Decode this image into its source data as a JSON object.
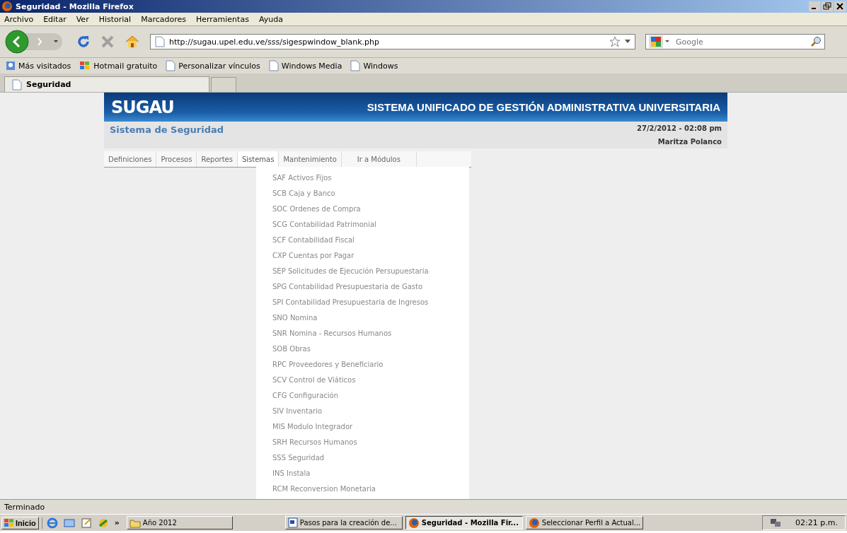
{
  "window": {
    "title": "Seguridad - Mozilla Firefox"
  },
  "menu_bar": [
    "Archivo",
    "Editar",
    "Ver",
    "Historial",
    "Marcadores",
    "Herramientas",
    "Ayuda"
  ],
  "address_bar": {
    "value": "http://sugau.upel.edu.ve/sss/sigespwindow_blank.php"
  },
  "search_field": {
    "placeholder": "Google"
  },
  "bookmarks": [
    {
      "label": "Más visitados",
      "kind": "smart"
    },
    {
      "label": "Hotmail gratuito",
      "kind": "windows"
    },
    {
      "label": "Personalizar vínculos",
      "kind": "page"
    },
    {
      "label": "Windows Media",
      "kind": "page"
    },
    {
      "label": "Windows",
      "kind": "page"
    }
  ],
  "tabs": [
    {
      "label": "Seguridad",
      "selected": true
    }
  ],
  "page": {
    "logo": "SUGAU",
    "banner_title": "SISTEMA UNIFICADO DE GESTIÓN ADMINISTRATIVA UNIVERSITARIA",
    "subtitle": "Sistema de Seguridad",
    "datetime": "27/2/2012 - 02:08 pm",
    "user": "Maritza Polanco",
    "menu": [
      {
        "label": "Definiciones",
        "selected": false
      },
      {
        "label": "Procesos",
        "selected": false
      },
      {
        "label": "Reportes",
        "selected": false
      },
      {
        "label": "Sistemas",
        "selected": true
      },
      {
        "label": "Mantenimiento",
        "selected": false
      },
      {
        "label": "Ir a Módulos",
        "selected": false
      }
    ],
    "dropdown": [
      "SAF Activos Fijos",
      "SCB Caja y Banco",
      "SOC Ordenes de Compra",
      "SCG Contabilidad Patrimonial",
      "SCF Contabilidad Fiscal",
      "CXP Cuentas por Pagar",
      "SEP Solicitudes de Ejecución Persupuestaria",
      "SPG Contabilidad Presupuestaria de Gasto",
      "SPI Contabilidad Presupuestaria de Ingresos",
      "SNO Nomina",
      "SNR Nomina - Recursos Humanos",
      "SOB Obras",
      "RPC Proveedores y Beneficiario",
      "SCV Control de Viáticos",
      "CFG Configuración",
      "SIV Inventario",
      "MIS Modulo Integrador",
      "SRH Recursos Humanos",
      "SSS Seguridad",
      "INS Instala",
      "RCM Reconversion Monetaria"
    ]
  },
  "status_bar": "Terminado",
  "taskbar": {
    "start": "Inicio",
    "more": "»",
    "tasks": [
      {
        "label": "Año 2012",
        "kind": "folder",
        "selected": false
      },
      {
        "label": "Pasos para la creación de...",
        "kind": "document",
        "selected": false
      },
      {
        "label": "Seguridad - Mozilla Fir...",
        "kind": "browser",
        "selected": true
      },
      {
        "label": "Seleccionar Perfil a Actual...",
        "kind": "browser",
        "selected": false
      }
    ],
    "clock": "02:21 p.m."
  }
}
